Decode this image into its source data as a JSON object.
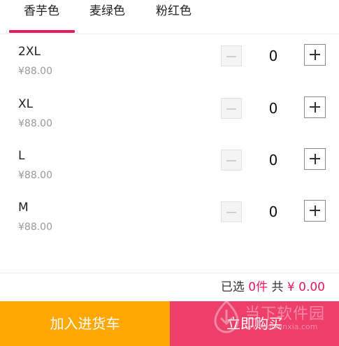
{
  "tabs": [
    {
      "label": "香芋色",
      "active": true
    },
    {
      "label": "麦绿色",
      "active": false
    },
    {
      "label": "粉红色",
      "active": false
    }
  ],
  "accent_color": "#e8185a",
  "rows": [
    {
      "size": "2XL",
      "price": "¥88.00",
      "quantity": "0"
    },
    {
      "size": "XL",
      "price": "¥88.00",
      "quantity": "0"
    },
    {
      "size": "L",
      "price": "¥88.00",
      "quantity": "0"
    },
    {
      "size": "M",
      "price": "¥88.00",
      "quantity": "0"
    }
  ],
  "icons": {
    "decrement": "minus-icon",
    "increment": "plus-icon"
  },
  "summary": {
    "selected_prefix": "已选",
    "selected_count": "0件",
    "total_prefix": "共",
    "total_value": "¥ 0.00"
  },
  "actions": {
    "add_to_cart": "加入进货车",
    "add_to_cart_color": "#ffa803",
    "buy_now": "立即购买",
    "buy_now_color": "#ed3f6a"
  },
  "watermark": {
    "text": "当下软件园",
    "url": "www.downxia.com"
  }
}
